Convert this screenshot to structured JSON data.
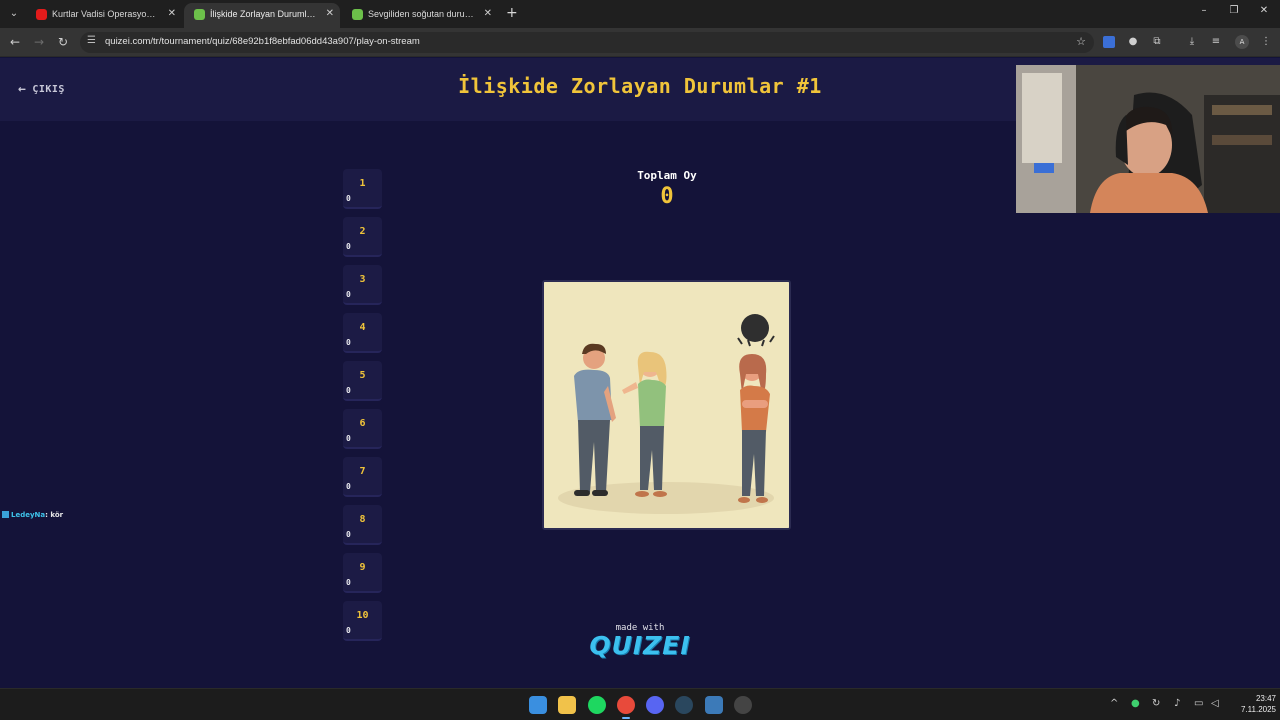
{
  "browser": {
    "tabs": [
      {
        "title": "Kurtlar Vadisi Operasyon Müziği",
        "favicon_color": "#e21b1b",
        "active": false
      },
      {
        "title": "İlişkide Zorlayan Durumlar #1 -",
        "favicon_color": "#6cc04a",
        "active": true
      },
      {
        "title": "Sevgiliden soğutan durumlar -",
        "favicon_color": "#6cc04a",
        "active": false
      }
    ],
    "new_tab_label": "+",
    "url": "quizei.com/tr/tournament/quiz/68e92b1f8ebfad06dd43a907/play-on-stream",
    "profile_initial": "A"
  },
  "page": {
    "exit_label": "ÇIKIŞ",
    "title": "İlişkide Zorlayan Durumlar #1",
    "vote_total_label": "Toplam Oy",
    "vote_total_value": "0",
    "ranks": [
      {
        "num": "1",
        "votes": "0"
      },
      {
        "num": "2",
        "votes": "0"
      },
      {
        "num": "3",
        "votes": "0"
      },
      {
        "num": "4",
        "votes": "0"
      },
      {
        "num": "5",
        "votes": "0"
      },
      {
        "num": "6",
        "votes": "0"
      },
      {
        "num": "7",
        "votes": "0"
      },
      {
        "num": "8",
        "votes": "0"
      },
      {
        "num": "9",
        "votes": "0"
      },
      {
        "num": "10",
        "votes": "0"
      }
    ],
    "made_with_label": "made with",
    "brand": "QUIZEI",
    "accent_color": "#f0c43a"
  },
  "chat": {
    "user": "LedeyNa",
    "separator": ":",
    "message": "kör"
  },
  "taskbar": {
    "time": "23:47",
    "date": "7.11.2025"
  }
}
